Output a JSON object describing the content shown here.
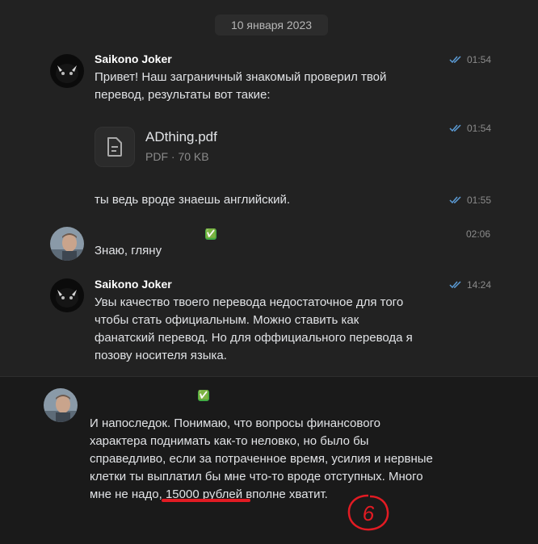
{
  "date_separator": "10 января 2023",
  "messages": [
    {
      "author": "Saikono Joker",
      "time": "01:54",
      "text_lines": [
        "Привет! Наш заграничный знакомый проверил твой",
        "перевод, результаты вот такие:"
      ]
    },
    {
      "time": "01:54",
      "attachment": {
        "name": "ADthing.pdf",
        "meta": "PDF · 70 KB"
      }
    },
    {
      "time": "01:55",
      "text_lines": [
        "ты ведь вроде знаешь английский."
      ]
    },
    {
      "time": "02:06",
      "text_lines": [
        "Знаю, гляну"
      ]
    },
    {
      "author": "Saikono Joker",
      "time": "14:24",
      "text_lines": [
        "Увы качество твоего перевода недостаточное для того",
        "чтобы стать официальным. Можно ставить как",
        "фанатский перевод. Но для оффициального перевода я",
        "позову носителя языка."
      ]
    },
    {
      "text_lines": [
        "И напоследок. Понимаю, что вопросы финансового",
        "характера поднимать как-то неловко, но было бы",
        "справедливо, если за потраченное время, усилия и нервные",
        "клетки ты выплатил бы мне что-то вроде отступных. Много"
      ],
      "last_line": {
        "before": "мне не надо, ",
        "highlight": "15000 рублей",
        "after": " вполне хватит."
      }
    }
  ],
  "status_marks": {
    "verified": "✅"
  },
  "annotation": {
    "number": "6",
    "color": "#e21b23"
  },
  "colors": {
    "read_ticks": "#5b9bd5",
    "highlight": "#e21b23",
    "verified": "#3fae45"
  }
}
